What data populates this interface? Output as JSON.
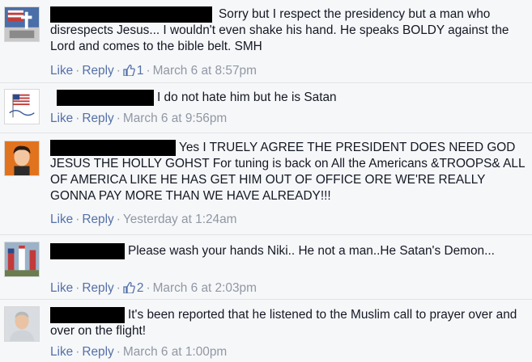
{
  "comments": [
    {
      "text": "Sorry but I respect the presidency but a man who disrespects Jesus... I wouldn't even shake his hand. He speaks BOLDY against the Lord and comes to the bible belt. SMH",
      "like_label": "Like",
      "reply_label": "Reply",
      "like_count": "1",
      "timestamp": "March 6 at 8:57pm",
      "avatar_icon": "flag-cross-avatar-icon"
    },
    {
      "text": "I do not hate him but he is Satan",
      "like_label": "Like",
      "reply_label": "Reply",
      "timestamp": "March 6 at 9:56pm",
      "avatar_icon": "american-flag-avatar-icon"
    },
    {
      "text": "Yes I TRUELY AGREE THE PRESIDENT DOES NEED GOD JESUS THE HOLLY GOHST For tuning is back on All the Americans &TROOPS& ALL OF AMERICA LIKE HE HAS GET HIM OUT OF OFFICE ORE WE'RE REALLY GONNA PAY MORE THAN WE HAVE ALREADY!!!",
      "like_label": "Like",
      "reply_label": "Reply",
      "timestamp": "Yesterday at 1:24am",
      "avatar_icon": "portrait-avatar-icon"
    },
    {
      "text": "Please wash your hands Niki.. He not a man..He Satan's Demon...",
      "like_label": "Like",
      "reply_label": "Reply",
      "like_count": "2",
      "timestamp": "March 6 at 2:03pm",
      "avatar_icon": "flags-avatar-icon"
    },
    {
      "text": "It's been reported that he listened to the Muslim call to prayer over and over on the flight!",
      "like_label": "Like",
      "reply_label": "Reply",
      "timestamp": "March 6 at 1:00pm",
      "avatar_icon": "man-avatar-icon"
    }
  ],
  "colors": {
    "link": "#5470a8",
    "meta": "#9197a3",
    "background": "#f6f7f9",
    "text": "#141823"
  }
}
